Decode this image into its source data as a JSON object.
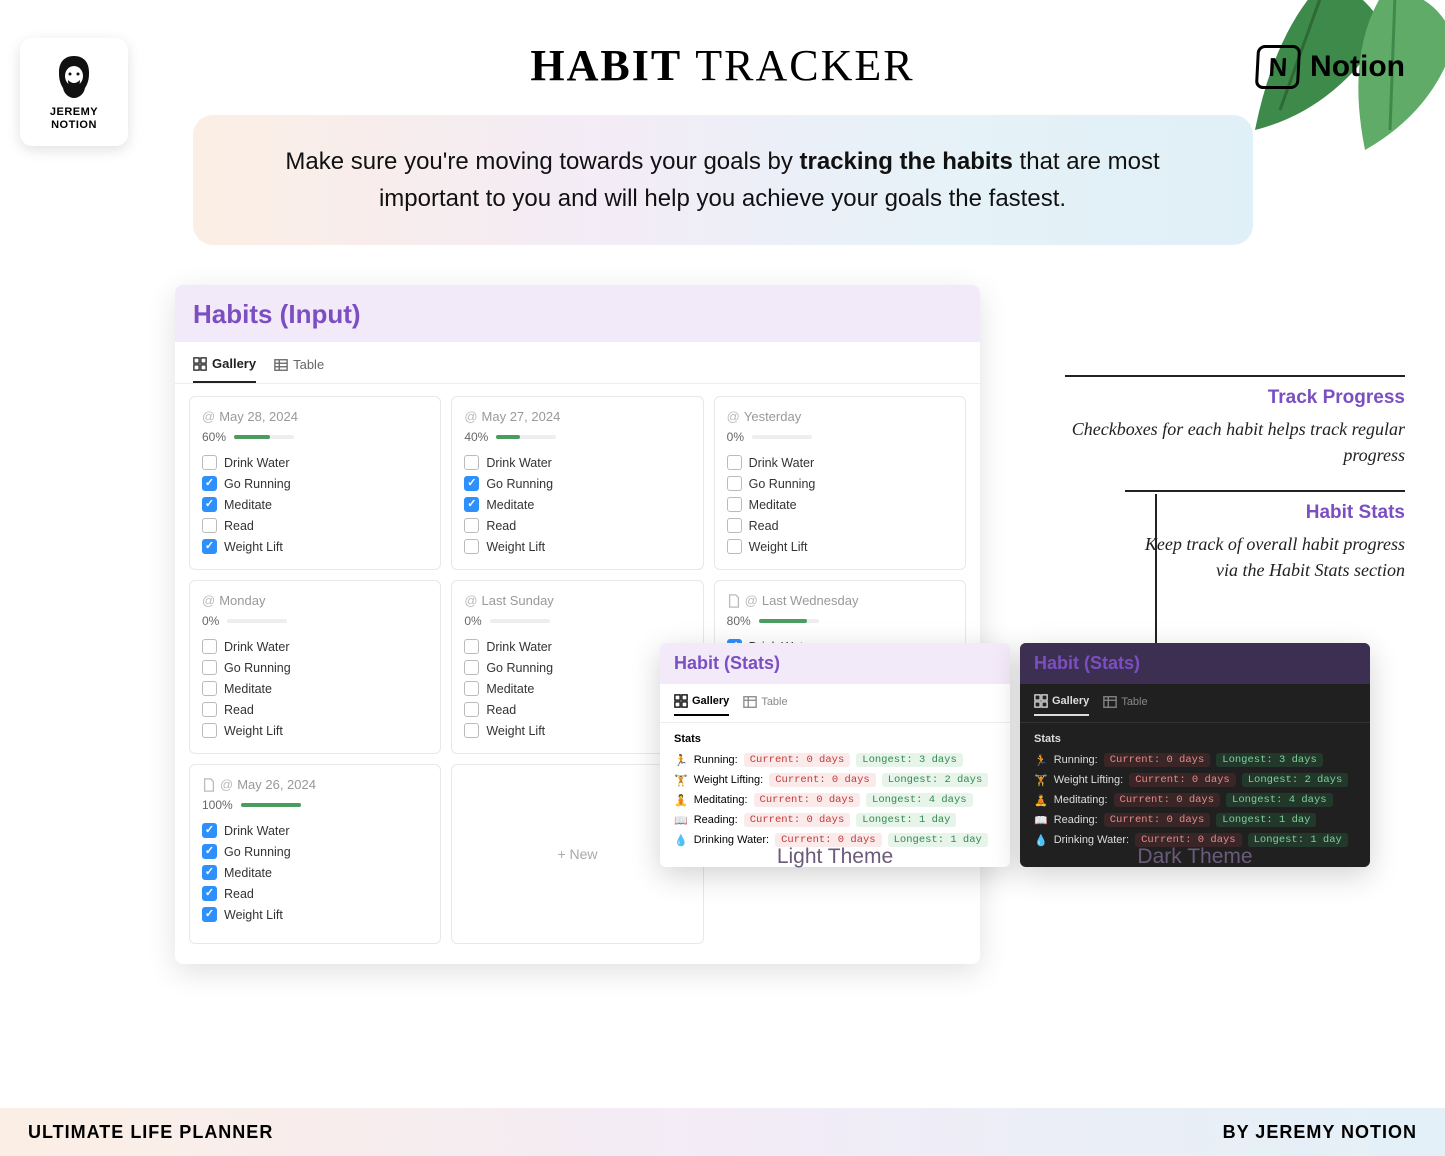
{
  "brand": {
    "name": "JEREMY\nNOTION",
    "notion": "Notion"
  },
  "title": {
    "bold": "HABIT",
    "regular": "TRACKER"
  },
  "subtitle": {
    "pre": "Make sure you're moving towards your goals by ",
    "strong": "tracking the habits",
    "post": " that are most important to you and will help you achieve your goals the fastest."
  },
  "panel": {
    "title": "Habits (Input)",
    "tabs": {
      "gallery": "Gallery",
      "table": "Table"
    },
    "habits": [
      "Drink Water",
      "Go Running",
      "Meditate",
      "Read",
      "Weight Lift"
    ],
    "new_label": "+  New",
    "cards": [
      {
        "date": "May 28, 2024",
        "percent": "60%",
        "bar": 60,
        "checked": [
          false,
          true,
          true,
          false,
          true
        ],
        "doc": false
      },
      {
        "date": "May 27, 2024",
        "percent": "40%",
        "bar": 40,
        "checked": [
          false,
          true,
          true,
          false,
          false
        ],
        "doc": false
      },
      {
        "date": "Yesterday",
        "percent": "0%",
        "bar": 0,
        "checked": [
          false,
          false,
          false,
          false,
          false
        ],
        "doc": false
      },
      {
        "date": "Monday",
        "percent": "0%",
        "bar": 0,
        "checked": [
          false,
          false,
          false,
          false,
          false
        ],
        "doc": false
      },
      {
        "date": "Last Sunday",
        "percent": "0%",
        "bar": 0,
        "checked": [
          false,
          false,
          false,
          false,
          false
        ],
        "doc": false
      },
      {
        "date": "Last Wednesday",
        "percent": "80%",
        "bar": 80,
        "checked": [
          true,
          false,
          true,
          true,
          true
        ],
        "doc": true,
        "truncate": 2
      },
      {
        "date": "May 26, 2024",
        "percent": "100%",
        "bar": 100,
        "checked": [
          true,
          true,
          true,
          true,
          true
        ],
        "doc": true
      }
    ]
  },
  "callouts": {
    "progress": {
      "title": "Track Progress",
      "body": "Checkboxes for each habit helps track regular progress"
    },
    "stats": {
      "title": "Habit Stats",
      "body": "Keep track of overall habit progress via the Habit Stats section"
    }
  },
  "stats": {
    "title": "Habit (Stats)",
    "tabs": {
      "gallery": "Gallery",
      "table": "Table"
    },
    "heading": "Stats",
    "rows": [
      {
        "emoji": "🏃",
        "name": "Running:",
        "current": "Current: 0 days",
        "longest": "Longest: 3 days"
      },
      {
        "emoji": "🏋️",
        "name": "Weight Lifting:",
        "current": "Current: 0 days",
        "longest": "Longest: 2 days"
      },
      {
        "emoji": "🧘",
        "name": "Meditating:",
        "current": "Current: 0 days",
        "longest": "Longest: 4 days"
      },
      {
        "emoji": "📖",
        "name": "Reading:",
        "current": "Current: 0 days",
        "longest": "Longest: 1 day"
      },
      {
        "emoji": "💧",
        "name": "Drinking Water:",
        "current": "Current: 0 days",
        "longest": "Longest: 1 day"
      }
    ]
  },
  "themes": {
    "light": "Light Theme",
    "dark": "Dark Theme"
  },
  "footer": {
    "left": "ULTIMATE LIFE PLANNER",
    "right": "BY JEREMY NOTION"
  }
}
